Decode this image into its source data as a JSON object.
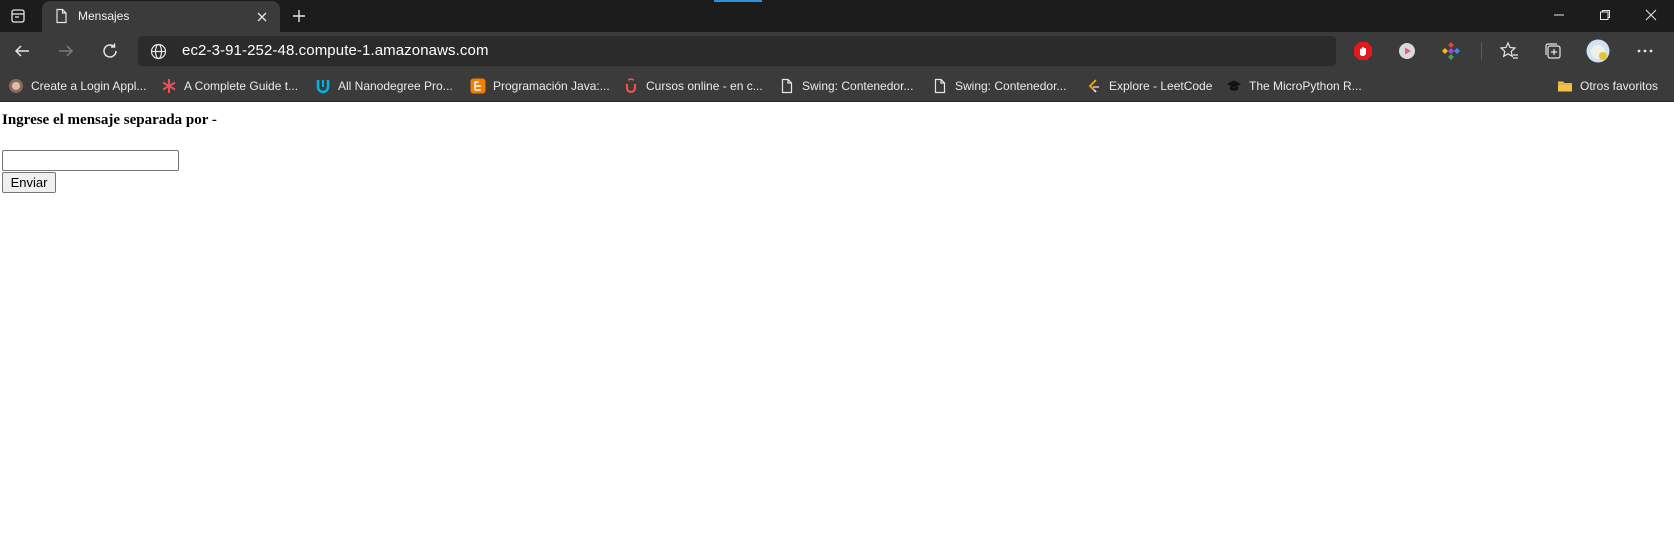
{
  "browser": {
    "tab": {
      "title": "Mensajes",
      "icon": "page-icon",
      "close_icon": "close-icon"
    },
    "new_tab_icon": "plus-icon",
    "window_controls": [
      "minimize-icon",
      "restore-icon",
      "close-icon"
    ],
    "toolbar": {
      "back_icon": "arrow-left-icon",
      "forward_icon": "arrow-right-icon",
      "refresh_icon": "refresh-icon",
      "address": "ec2-3-91-252-48.compute-1.amazonaws.com",
      "address_icon": "globe-icon",
      "extensions": [
        "adblock-icon",
        "media-icon",
        "color-picker-icon"
      ],
      "favorites_icon": "favorites-icon",
      "collections_icon": "collections-icon",
      "profile_icon": "avatar",
      "menu_icon": "ellipsis-icon"
    },
    "bookmarks": [
      {
        "label": "Create a Login Appl...",
        "icon": "bookmark-favicon"
      },
      {
        "label": "A Complete Guide t...",
        "icon": "asterisk-icon",
        "color": "#e8505b"
      },
      {
        "label": "All Nanodegree Pro...",
        "icon": "udacity-icon",
        "color": "#02b3e4"
      },
      {
        "label": "Programación Java:...",
        "icon": "blogger-icon",
        "color": "#f57d00"
      },
      {
        "label": "Cursos online - en c...",
        "icon": "udemy-icon",
        "color": "#ec5252"
      },
      {
        "label": "Swing: Contenedor...",
        "icon": "page-icon"
      },
      {
        "label": "Swing: Contenedor...",
        "icon": "page-icon"
      },
      {
        "label": "Explore - LeetCode",
        "icon": "leetcode-icon",
        "color": "#ffa116"
      },
      {
        "label": "The MicroPython R...",
        "icon": "graduation-cap-icon"
      }
    ],
    "other_favorites": {
      "label": "Otros favoritos",
      "icon": "folder-icon",
      "color": "#f0c14b"
    }
  },
  "page": {
    "heading": "Ingrese el mensaje separada por -",
    "input": {
      "value": "",
      "placeholder": ""
    },
    "submit_label": "Enviar"
  }
}
